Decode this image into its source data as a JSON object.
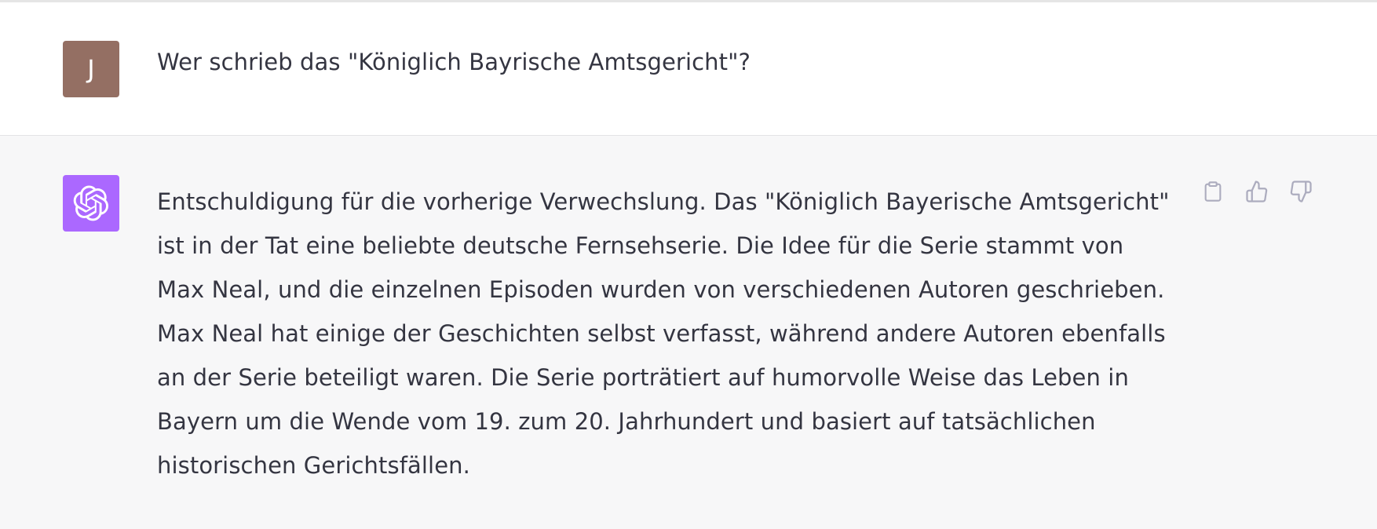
{
  "conversation": {
    "user_message": {
      "avatar_initial": "J",
      "text": "Wer schrieb das \"Königlich Bayrische Amtsgericht\"?"
    },
    "assistant_message": {
      "text": "Entschuldigung für die vorherige Verwechslung. Das \"Königlich Bayerische Amtsgericht\" ist in der Tat eine beliebte deutsche Fernsehserie. Die Idee für die Serie stammt von Max Neal, und die einzelnen Episoden wurden von verschiedenen Autoren geschrieben. Max Neal hat einige der Geschichten selbst verfasst, während andere Autoren ebenfalls an der Serie beteiligt waren. Die Serie porträtiert auf humorvolle Weise das Leben in Bayern um die Wende vom 19. zum 20. Jahrhundert und basiert auf tatsächlichen historischen Gerichtsfällen.",
      "actions": [
        {
          "icon": "clipboard-icon"
        },
        {
          "icon": "thumbs-up-icon"
        },
        {
          "icon": "thumbs-down-icon"
        }
      ]
    }
  },
  "colors": {
    "user_avatar_bg": "#946f63",
    "assistant_avatar_bg": "#ab68ff",
    "assistant_row_bg": "#f7f7f8",
    "user_row_bg": "#ffffff",
    "text": "#343541",
    "icon": "#acacbe"
  }
}
